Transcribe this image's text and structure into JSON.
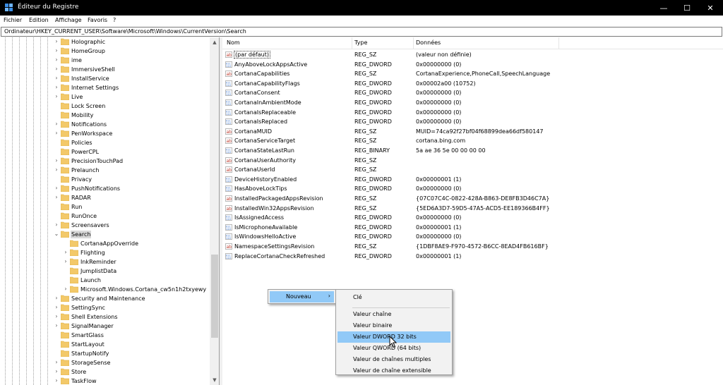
{
  "window": {
    "title": "Éditeur du Registre",
    "app_icon": "registry-editor-icon",
    "controls": {
      "minimize": "—",
      "maximize": "☐",
      "close": "✕"
    }
  },
  "menu": [
    "Fichier",
    "Edition",
    "Affichage",
    "Favoris",
    "?"
  ],
  "address": "Ordinateur\\HKEY_CURRENT_USER\\Software\\Microsoft\\Windows\\CurrentVersion\\Search",
  "tree": {
    "items": [
      {
        "label": "Holographic",
        "expander": "›"
      },
      {
        "label": "HomeGroup",
        "expander": "›"
      },
      {
        "label": "ime",
        "expander": "›"
      },
      {
        "label": "ImmersiveShell",
        "expander": "›"
      },
      {
        "label": "InstallService",
        "expander": "›"
      },
      {
        "label": "Internet Settings",
        "expander": "›"
      },
      {
        "label": "Live",
        "expander": "›"
      },
      {
        "label": "Lock Screen",
        "expander": ""
      },
      {
        "label": "Mobility",
        "expander": ""
      },
      {
        "label": "Notifications",
        "expander": "›"
      },
      {
        "label": "PenWorkspace",
        "expander": "›"
      },
      {
        "label": "Policies",
        "expander": ""
      },
      {
        "label": "PowerCPL",
        "expander": ""
      },
      {
        "label": "PrecisionTouchPad",
        "expander": "›"
      },
      {
        "label": "Prelaunch",
        "expander": "›"
      },
      {
        "label": "Privacy",
        "expander": ""
      },
      {
        "label": "PushNotifications",
        "expander": "›"
      },
      {
        "label": "RADAR",
        "expander": "›"
      },
      {
        "label": "Run",
        "expander": ""
      },
      {
        "label": "RunOnce",
        "expander": ""
      },
      {
        "label": "Screensavers",
        "expander": "›"
      },
      {
        "label": "Search",
        "expander": "⌄",
        "selected": true
      },
      {
        "label": "CortanaAppOverride",
        "expander": "",
        "child": true
      },
      {
        "label": "Flighting",
        "expander": "›",
        "child": true
      },
      {
        "label": "InkReminder",
        "expander": "›",
        "child": true
      },
      {
        "label": "JumplistData",
        "expander": "",
        "child": true
      },
      {
        "label": "Launch",
        "expander": "",
        "child": true
      },
      {
        "label": "Microsoft.Windows.Cortana_cw5n1h2txyewy",
        "expander": "›",
        "child": true
      },
      {
        "label": "Security and Maintenance",
        "expander": "›"
      },
      {
        "label": "SettingSync",
        "expander": "›"
      },
      {
        "label": "Shell Extensions",
        "expander": "›"
      },
      {
        "label": "SignalManager",
        "expander": "›"
      },
      {
        "label": "SmartGlass",
        "expander": ""
      },
      {
        "label": "StartLayout",
        "expander": ""
      },
      {
        "label": "StartupNotify",
        "expander": ""
      },
      {
        "label": "StorageSense",
        "expander": "›"
      },
      {
        "label": "Store",
        "expander": "›"
      },
      {
        "label": "TaskFlow",
        "expander": "›"
      }
    ]
  },
  "list": {
    "columns": {
      "name": "Nom",
      "type": "Type",
      "data": "Données"
    },
    "rows": [
      {
        "name": "(par défaut)",
        "type": "REG_SZ",
        "data": "(valeur non définie)",
        "icon": "string-value-icon"
      },
      {
        "name": "AnyAboveLockAppsActive",
        "type": "REG_DWORD",
        "data": "0x00000000 (0)",
        "icon": "binary-value-icon"
      },
      {
        "name": "CortanaCapabilities",
        "type": "REG_SZ",
        "data": "CortanaExperience,PhoneCall,SpeechLanguage",
        "icon": "string-value-icon"
      },
      {
        "name": "CortanaCapabilityFlags",
        "type": "REG_DWORD",
        "data": "0x00002a00 (10752)",
        "icon": "binary-value-icon"
      },
      {
        "name": "CortanaConsent",
        "type": "REG_DWORD",
        "data": "0x00000000 (0)",
        "icon": "binary-value-icon"
      },
      {
        "name": "CortanaInAmbientMode",
        "type": "REG_DWORD",
        "data": "0x00000000 (0)",
        "icon": "binary-value-icon"
      },
      {
        "name": "CortanaIsReplaceable",
        "type": "REG_DWORD",
        "data": "0x00000000 (0)",
        "icon": "binary-value-icon"
      },
      {
        "name": "CortanaIsReplaced",
        "type": "REG_DWORD",
        "data": "0x00000000 (0)",
        "icon": "binary-value-icon"
      },
      {
        "name": "CortanaMUID",
        "type": "REG_SZ",
        "data": "MUID=74ca92f27bf04f68899dea66df580147",
        "icon": "string-value-icon"
      },
      {
        "name": "CortanaServiceTarget",
        "type": "REG_SZ",
        "data": "cortana.bing.com",
        "icon": "string-value-icon"
      },
      {
        "name": "CortanaStateLastRun",
        "type": "REG_BINARY",
        "data": "5a ae 36 5e 00 00 00 00",
        "icon": "binary-value-icon"
      },
      {
        "name": "CortanaUserAuthority",
        "type": "REG_SZ",
        "data": "",
        "icon": "string-value-icon"
      },
      {
        "name": "CortanaUserId",
        "type": "REG_SZ",
        "data": "",
        "icon": "string-value-icon"
      },
      {
        "name": "DeviceHistoryEnabled",
        "type": "REG_DWORD",
        "data": "0x00000001 (1)",
        "icon": "binary-value-icon"
      },
      {
        "name": "HasAboveLockTips",
        "type": "REG_DWORD",
        "data": "0x00000000 (0)",
        "icon": "binary-value-icon"
      },
      {
        "name": "InstalledPackagedAppsRevision",
        "type": "REG_SZ",
        "data": "{07C07C4C-0822-428A-B863-DE8FB3D46C7A}",
        "icon": "string-value-icon"
      },
      {
        "name": "InstalledWin32AppsRevision",
        "type": "REG_SZ",
        "data": "{5ED6A3D7-59D5-47A5-ACD5-EE189366B4FF}",
        "icon": "string-value-icon"
      },
      {
        "name": "IsAssignedAccess",
        "type": "REG_DWORD",
        "data": "0x00000000 (0)",
        "icon": "binary-value-icon"
      },
      {
        "name": "IsMicrophoneAvailable",
        "type": "REG_DWORD",
        "data": "0x00000001 (1)",
        "icon": "binary-value-icon"
      },
      {
        "name": "IsWindowsHelloActive",
        "type": "REG_DWORD",
        "data": "0x00000000 (0)",
        "icon": "binary-value-icon"
      },
      {
        "name": "NamespaceSettingsRevision",
        "type": "REG_SZ",
        "data": "{1DBF8AE9-F970-4572-B6CC-8EAD4FB616BF}",
        "icon": "string-value-icon"
      },
      {
        "name": "ReplaceCortanaCheckRefreshed",
        "type": "REG_DWORD",
        "data": "0x00000001 (1)",
        "icon": "binary-value-icon"
      }
    ]
  },
  "context_menu": {
    "parent_label": "Nouveau",
    "parent_arrow": "›",
    "submenu": [
      "Clé",
      "Valeur chaîne",
      "Valeur binaire",
      "Valeur DWORD 32 bits",
      "Valeur QWORD (64 bits)",
      "Valeur de chaînes multiples",
      "Valeur de chaîne extensible"
    ],
    "highlighted": "Valeur DWORD 32 bits"
  },
  "colors": {
    "titlebar": "#000000",
    "folder": "#f3c969",
    "menu_highlight": "#91c9f7",
    "string_icon": "#c0392b",
    "binary_icon": "#2f6fcf"
  }
}
